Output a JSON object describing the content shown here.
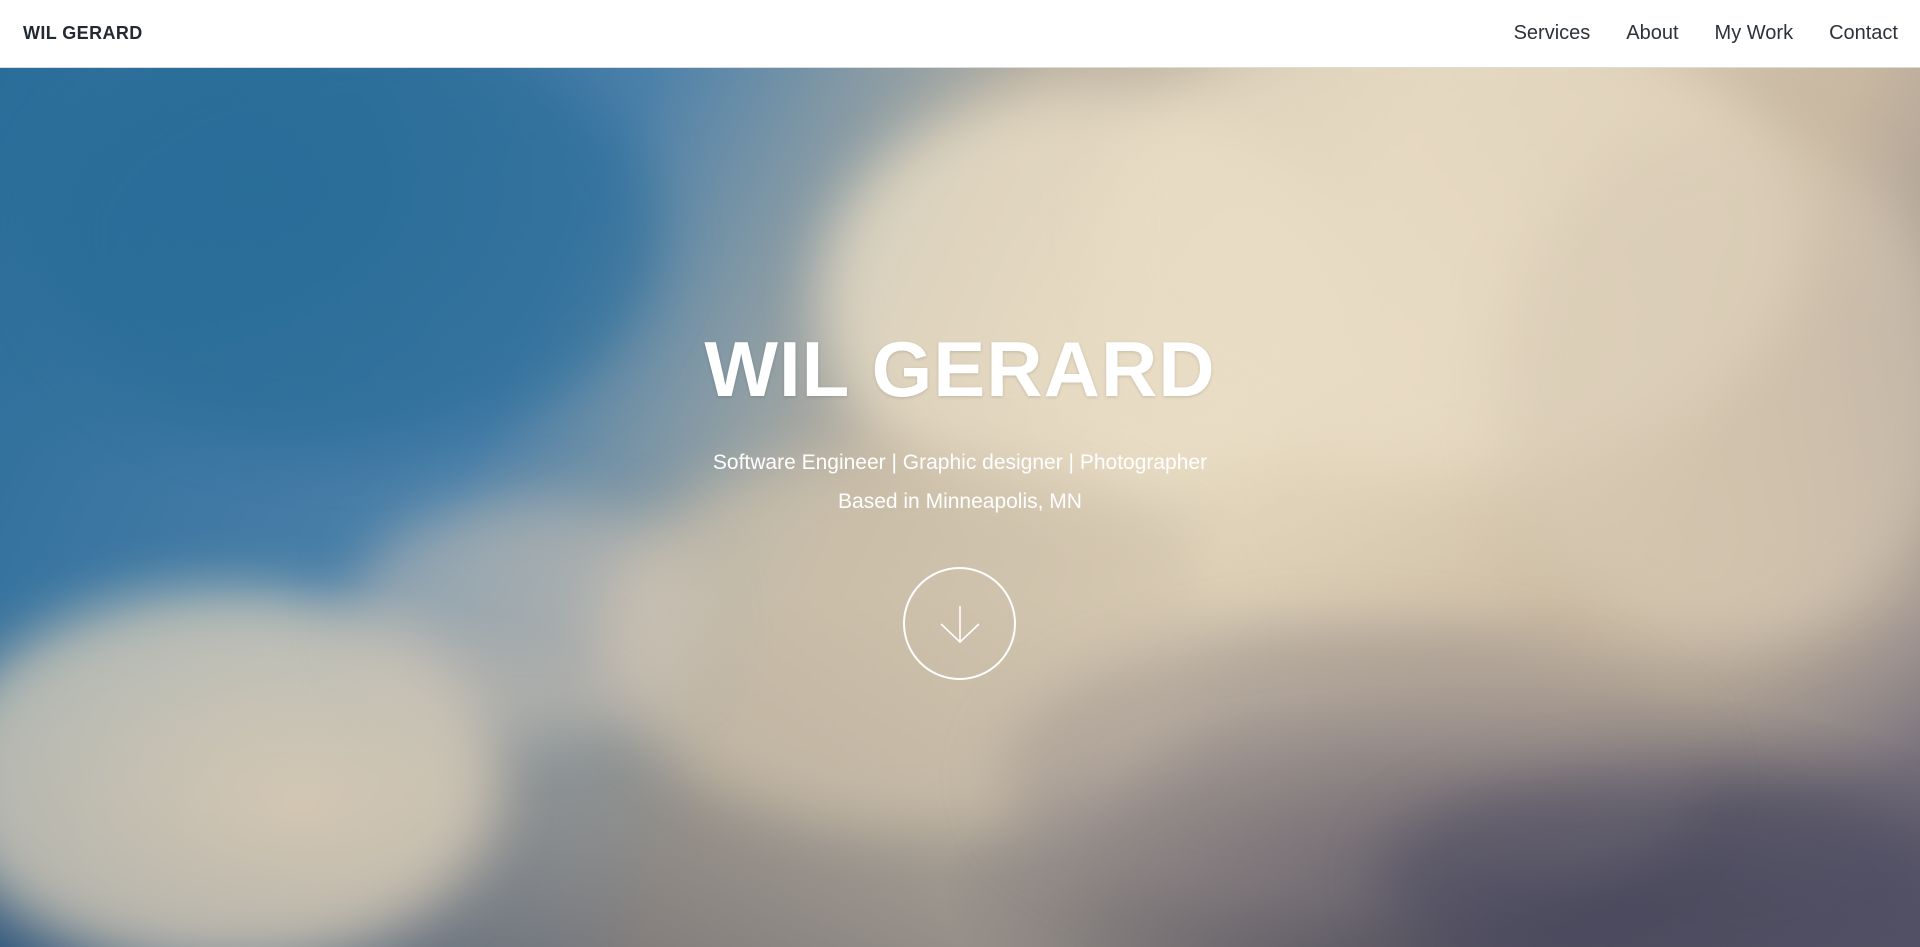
{
  "navbar": {
    "brand": "WIL GERARD",
    "links": [
      {
        "label": "Services"
      },
      {
        "label": "About"
      },
      {
        "label": "My Work"
      },
      {
        "label": "Contact"
      }
    ]
  },
  "hero": {
    "title": "WIL GERARD",
    "subtitle": "Software Engineer | Graphic designer | Photographer",
    "location": "Based in Minneapolis, MN",
    "scroll_icon": "arrow-down-icon"
  },
  "colors": {
    "nav_background": "#ffffff",
    "nav_text": "#2b3239",
    "hero_text": "#ffffff",
    "sky_blue": "#2a6c99",
    "cloud_cream": "#e2d5bc"
  }
}
